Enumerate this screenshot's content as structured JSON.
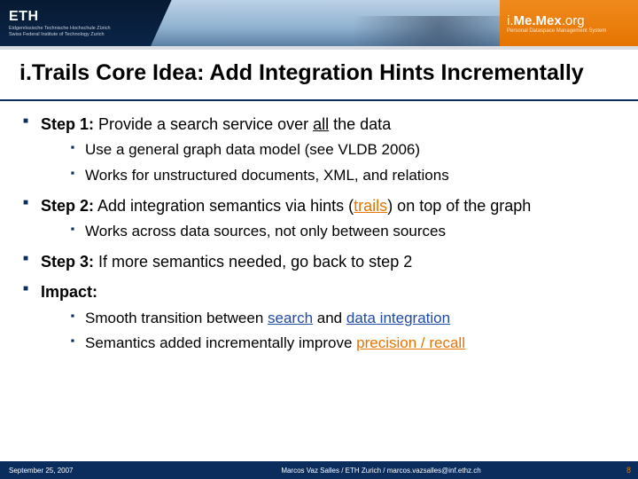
{
  "header": {
    "eth_logo": "ETH",
    "eth_sub1": "Eidgenössische Technische Hochschule Zürich",
    "eth_sub2": "Swiss Federal Institute of Technology Zurich",
    "brand_pre": "i.",
    "brand_mid": "Me.Mex",
    "brand_suf": ".org",
    "brand_sub": "Personal Dataspace Management System"
  },
  "title": "i.Trails Core Idea: Add Integration Hints Incrementally",
  "bullets": [
    {
      "label": {
        "bold": "Step 1:",
        "rest_a": " Provide a search service over ",
        "u": "all",
        "rest_b": " the data"
      },
      "sub": [
        {
          "plain": "Use a general graph data model (see VLDB 2006)"
        },
        {
          "plain": "Works for unstructured documents, XML, and relations"
        }
      ]
    },
    {
      "label": {
        "bold": "Step 2:",
        "rest_a": " Add integration semantics via hints (",
        "hl": "trails",
        "hlclass": "hl-orange u",
        "rest_b": ") on top of the graph"
      },
      "sub": [
        {
          "plain": "Works across data sources, not only between sources"
        }
      ]
    },
    {
      "label": {
        "bold": "Step 3:",
        "rest_a": " If more semantics needed, go back to step 2"
      },
      "sub": []
    },
    {
      "label": {
        "bold": "Impact:"
      },
      "sub": [
        {
          "pre": "Smooth transition between ",
          "a": "search",
          "aclass": "hl-blue u",
          "mid": " and ",
          "b": "data integration",
          "bclass": "hl-blue u"
        },
        {
          "pre": "Semantics added incrementally improve ",
          "a": "precision / recall",
          "aclass": "hl-orange u"
        }
      ]
    }
  ],
  "footer": {
    "date": "September 25, 2007",
    "center": "Marcos Vaz Salles / ETH Zurich / marcos.vazsalles@inf.ethz.ch",
    "page": "8"
  }
}
